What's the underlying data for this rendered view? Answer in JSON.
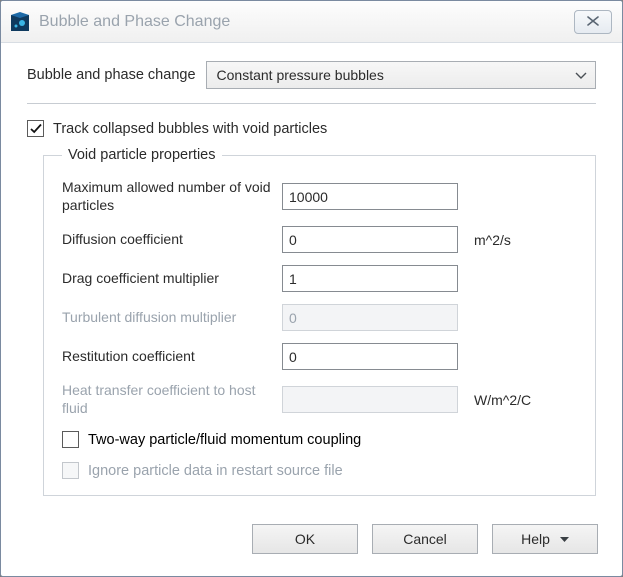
{
  "titlebar": {
    "title": "Bubble and Phase Change"
  },
  "top": {
    "label": "Bubble and phase change",
    "selected": "Constant pressure bubbles"
  },
  "track": {
    "checked": true,
    "label": "Track collapsed bubbles with void particles"
  },
  "group": {
    "legend": "Void particle properties",
    "rows": {
      "max": {
        "label": "Maximum allowed number of void particles",
        "value": "10000",
        "unit": ""
      },
      "diff": {
        "label": "Diffusion coefficient",
        "value": "0",
        "unit": "m^2/s"
      },
      "drag": {
        "label": "Drag coefficient multiplier",
        "value": "1",
        "unit": ""
      },
      "turb": {
        "label": "Turbulent diffusion multiplier",
        "value": "0",
        "unit": "",
        "disabled": true
      },
      "rest": {
        "label": "Restitution coefficient",
        "value": "0",
        "unit": ""
      },
      "heat": {
        "label": "Heat transfer coefficient to host fluid",
        "value": "",
        "unit": "W/m^2/C",
        "disabled": true
      }
    },
    "twoway": {
      "checked": false,
      "label": "Two-way particle/fluid momentum coupling"
    },
    "ignore": {
      "checked": false,
      "disabled": true,
      "label": "Ignore particle data in restart source file"
    }
  },
  "buttons": {
    "ok": "OK",
    "cancel": "Cancel",
    "help": "Help"
  }
}
